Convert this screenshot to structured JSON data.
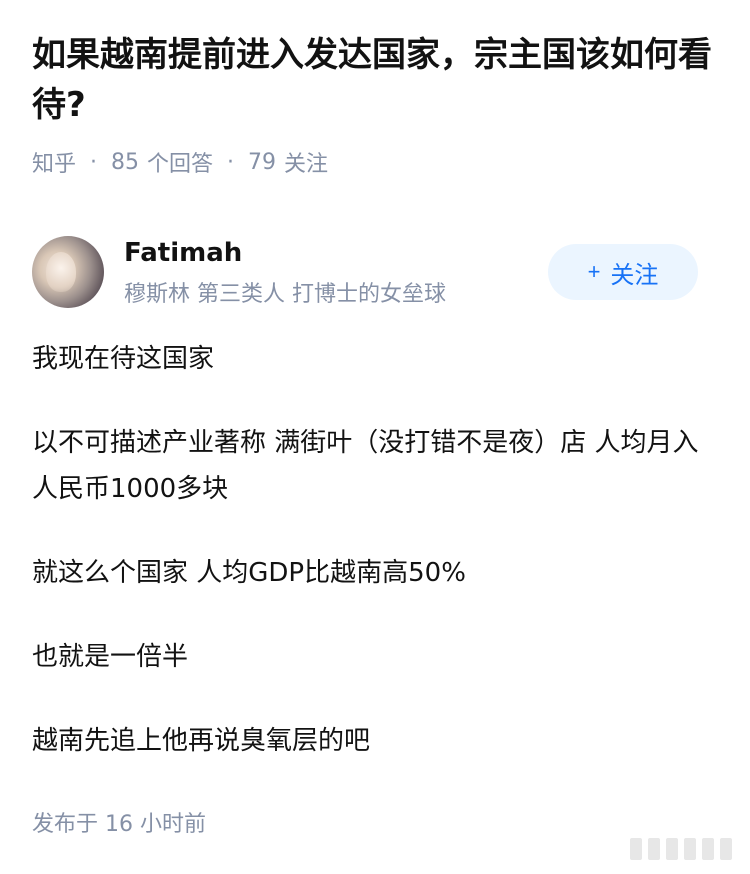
{
  "question": {
    "title": "如果越南提前进入发达国家，宗主国该如何看待?",
    "source": "知乎",
    "answers_count": "85",
    "answers_label": "个回答",
    "followers_count": "79",
    "followers_label": "关注"
  },
  "author": {
    "name": "Fatimah",
    "bio": "穆斯林 第三类人 打博士的女垒球",
    "follow_plus": "+",
    "follow_label": "关注"
  },
  "answer": {
    "paragraphs": [
      "我现在待这国家",
      "以不可描述产业著称 满街叶（没打错不是夜）店 人均月入人民币1000多块",
      "就这么个国家 人均GDP比越南高50%",
      "也就是一倍半",
      "越南先追上他再说臭氧层的吧"
    ],
    "published_label": "发布于",
    "published_time": "16 小时前"
  },
  "colors": {
    "title": "#121212",
    "meta": "#8590a6",
    "follow_bg": "#ebf5ff",
    "follow_text": "#1772f6"
  }
}
